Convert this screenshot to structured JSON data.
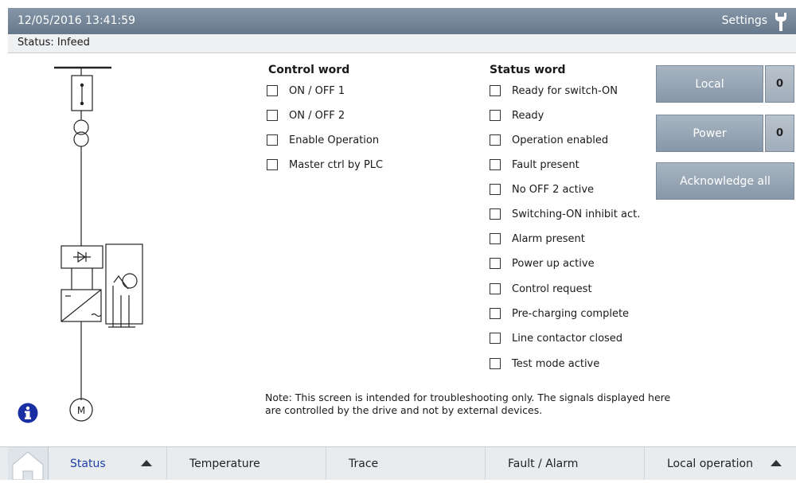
{
  "header": {
    "datetime": "12/05/2016 13:41:59",
    "settings_label": "Settings"
  },
  "status_bar": {
    "text": "Status: Infeed"
  },
  "control_word": {
    "title": "Control word",
    "items": [
      {
        "label": "ON / OFF 1",
        "checked": false
      },
      {
        "label": "ON / OFF 2",
        "checked": false
      },
      {
        "label": "Enable Operation",
        "checked": false
      },
      {
        "label": "Master ctrl by PLC",
        "checked": false
      }
    ]
  },
  "status_word": {
    "title": "Status word",
    "items": [
      {
        "label": "Ready for switch-ON",
        "checked": false
      },
      {
        "label": "Ready",
        "checked": false
      },
      {
        "label": "Operation enabled",
        "checked": false
      },
      {
        "label": "Fault present",
        "checked": false
      },
      {
        "label": "No OFF 2 active",
        "checked": false
      },
      {
        "label": "Switching-ON inhibit act.",
        "checked": false
      },
      {
        "label": "Alarm present",
        "checked": false
      },
      {
        "label": "Power up active",
        "checked": false
      },
      {
        "label": "Control request",
        "checked": false
      },
      {
        "label": "Pre-charging complete",
        "checked": false
      },
      {
        "label": "Line contactor closed",
        "checked": false
      },
      {
        "label": "Test mode active",
        "checked": false
      }
    ]
  },
  "buttons": {
    "local_label": "Local",
    "local_indicator": "0",
    "power_label": "Power",
    "power_indicator": "0",
    "acknowledge_label": "Acknowledge all"
  },
  "note": {
    "line1": "Note: This screen is intended for troubleshooting only. The signals displayed here",
    "line2": "are controlled by the drive and not by external devices."
  },
  "diagram": {
    "motor_label": "M"
  },
  "footer": {
    "tabs": [
      {
        "label": "Status"
      },
      {
        "label": "Temperature"
      },
      {
        "label": "Trace"
      },
      {
        "label": "Fault / Alarm"
      },
      {
        "label": "Local operation"
      }
    ]
  },
  "colors": {
    "header_bg": "#6f8194",
    "button_bg": "#98a7b7",
    "active_tab": "#1c3fa8",
    "info_icon": "#1a2fa3"
  }
}
